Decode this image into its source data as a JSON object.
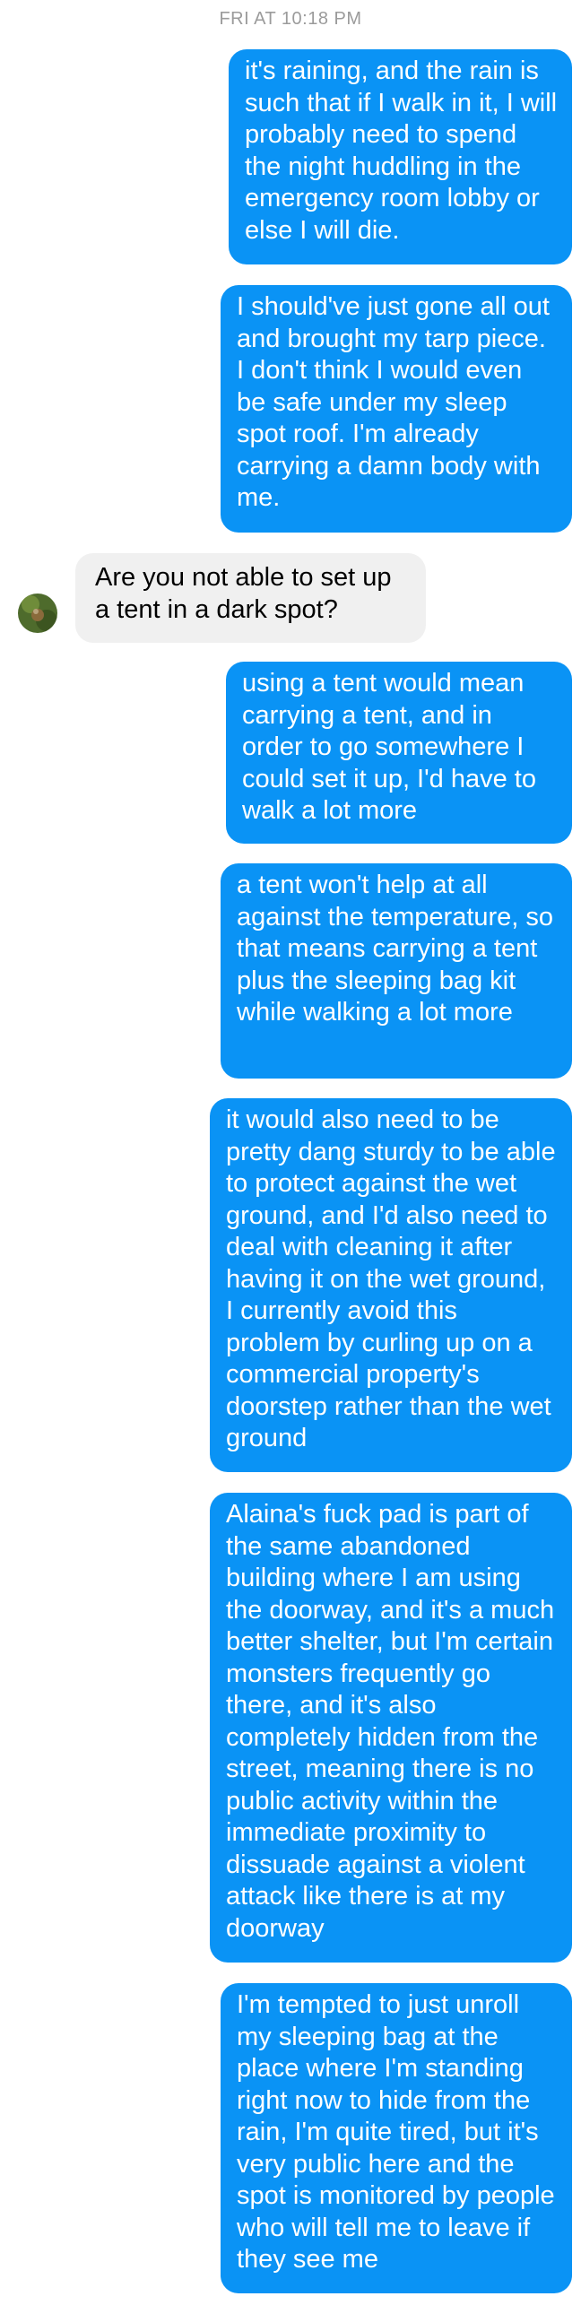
{
  "conversation": {
    "timestamp": "FRI AT 10:18 PM",
    "messages": [
      {
        "direction": "outgoing",
        "text": "it's raining, and the rain is such that if I walk in it, I will probably need to spend the night huddling in the emergency room lobby or else I will die."
      },
      {
        "direction": "outgoing",
        "text": "I should've just gone all out and brought my tarp piece. I don't think I would even be safe under my sleep spot roof. I'm already carrying a damn body with me."
      },
      {
        "direction": "incoming",
        "text": "Are you not able to set up a tent in a dark spot?"
      },
      {
        "direction": "outgoing",
        "text": "using a tent would mean carrying a tent, and in order to go somewhere I could set it up, I'd have to walk a lot more"
      },
      {
        "direction": "outgoing",
        "text": "a tent won't help at all against the temperature, so that means carrying a tent plus the sleeping bag kit while walking a lot more"
      },
      {
        "direction": "outgoing",
        "text": "it would also need to be pretty dang sturdy to be able to protect against the wet ground, and I'd also need to deal with cleaning it after having it on the wet ground, I currently avoid this problem by curling up on a commercial property's doorstep rather than the wet ground"
      },
      {
        "direction": "outgoing",
        "text": "Alaina's fuck pad is part of the same abandoned building where I am using the doorway, and it's a much better shelter, but I'm certain monsters frequently go there, and it's also completely hidden from the street, meaning there is no public activity within the immediate proximity to dissuade against a violent attack like there is at my doorway"
      },
      {
        "direction": "outgoing",
        "text": "I'm tempted to just unroll my sleeping bag at the place where I'm standing right now to hide from the rain, I'm quite tired, but it's very public here and the spot is monitored by people who will tell me to leave if they see me"
      }
    ]
  },
  "colors": {
    "outgoing_bubble": "#0a93f5",
    "incoming_bubble": "#f0f0f0",
    "timestamp_text": "#9b9b9b"
  },
  "icons": {
    "avatar": "contact-avatar"
  }
}
